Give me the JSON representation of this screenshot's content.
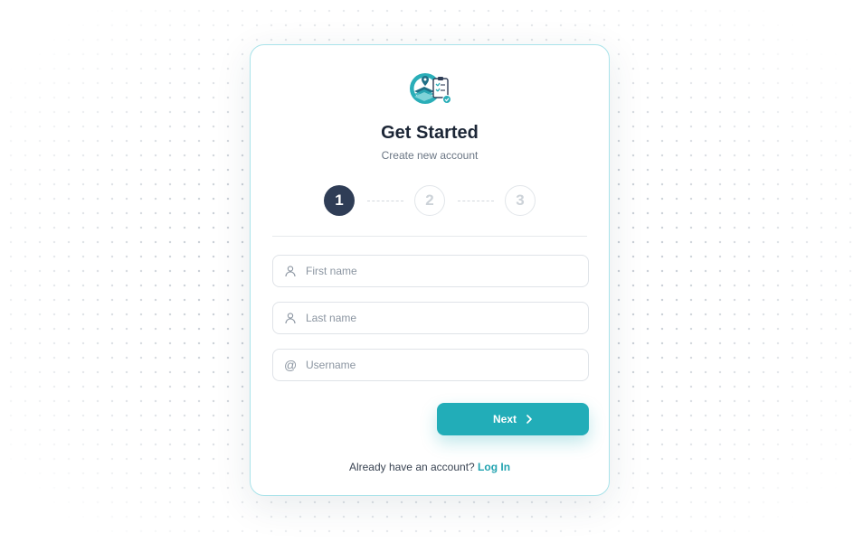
{
  "header": {
    "logo_icon": "map-clipboard-logo-icon",
    "title": "Get Started",
    "subtitle": "Create new account"
  },
  "stepper": {
    "steps": [
      {
        "label": "1",
        "state": "active"
      },
      {
        "label": "2",
        "state": "inactive"
      },
      {
        "label": "3",
        "state": "inactive"
      }
    ]
  },
  "form": {
    "first_name": {
      "placeholder": "First name",
      "value": "",
      "icon": "user-icon"
    },
    "last_name": {
      "placeholder": "Last name",
      "value": "",
      "icon": "user-icon"
    },
    "username": {
      "placeholder": "Username",
      "value": "",
      "icon": "at-sign-icon"
    }
  },
  "actions": {
    "next_label": "Next",
    "next_icon": "chevron-right-icon"
  },
  "footer": {
    "prompt": "Already have an account?",
    "login_label": "Log In"
  },
  "colors": {
    "accent": "#22adb8",
    "active_step": "#2f3d56",
    "card_border": "#a9e3ea",
    "title": "#1c2636"
  }
}
